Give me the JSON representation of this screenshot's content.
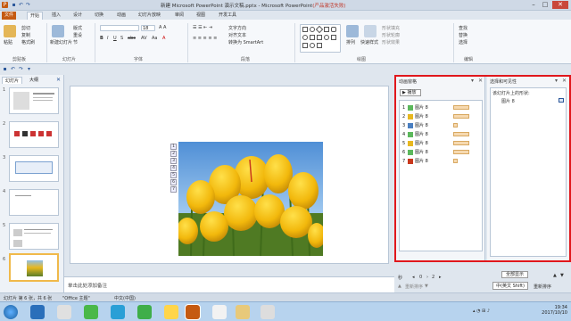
{
  "window": {
    "title": "新建 Microsoft PowerPoint 演示文稿.pptx - Microsoft PowerPoint",
    "title_suffix": "(产品激活失败)",
    "controls": [
      "–",
      "□",
      "✕"
    ]
  },
  "quick_access": [
    "save",
    "undo",
    "redo"
  ],
  "tabs": [
    {
      "label": "文件",
      "active": false
    },
    {
      "label": "开始",
      "active": true
    },
    {
      "label": "插入",
      "active": false
    },
    {
      "label": "设计",
      "active": false
    },
    {
      "label": "切换",
      "active": false
    },
    {
      "label": "动画",
      "active": false
    },
    {
      "label": "幻灯片放映",
      "active": false
    },
    {
      "label": "审阅",
      "active": false
    },
    {
      "label": "视图",
      "active": false
    },
    {
      "label": "开发工具",
      "active": false
    }
  ],
  "ribbon": {
    "clipboard": {
      "paste": "粘贴",
      "cut": "剪切",
      "copy": "复制",
      "format": "格式刷",
      "label": "剪贴板"
    },
    "slides": {
      "new_slide": "新建幻灯片",
      "layout": "版式",
      "reset": "重设",
      "section": "节",
      "label": "幻灯片"
    },
    "font": {
      "label": "字体",
      "size": "18"
    },
    "paragraph": {
      "text_direction": "文字方向",
      "align_text": "对齐文本",
      "smartart": "转换为 SmartArt",
      "label": "段落"
    },
    "drawing": {
      "arrange": "排列",
      "quick_styles": "快速样式",
      "fill": "形状填充",
      "outline": "形状轮廓",
      "effects": "形状效果",
      "label": "绘图"
    },
    "editing": {
      "find": "查找",
      "replace": "替换",
      "select": "选择",
      "label": "编辑"
    }
  },
  "left_panel": {
    "tabs": [
      "幻灯片",
      "大纲"
    ],
    "slide_numbers": [
      "1",
      "2",
      "3",
      "4",
      "5",
      "6"
    ],
    "selected": 6
  },
  "slide": {
    "anim_tags": [
      "1",
      "2",
      "3",
      "4",
      "5",
      "6",
      "7"
    ]
  },
  "notes_placeholder": "单击此处添加备注",
  "animation_pane": {
    "title": "动画窗格",
    "play": "播放",
    "items": [
      {
        "num": "1",
        "label": "图片 8",
        "bar": 0.6
      },
      {
        "num": "2",
        "label": "图片 8",
        "bar": 0.6
      },
      {
        "num": "3",
        "label": "图片 8",
        "bar": 0.15
      },
      {
        "num": "4",
        "label": "图片 8",
        "bar": 0.6
      },
      {
        "num": "5",
        "label": "图片 8",
        "bar": 0.6
      },
      {
        "num": "6",
        "label": "图片 8",
        "bar": 0.6
      },
      {
        "num": "7",
        "label": "图片 8",
        "bar": 0.15
      }
    ],
    "seconds_label": "秒",
    "start": "0",
    "end": "2",
    "reorder": "重新排序"
  },
  "selection_pane": {
    "title": "选择和可见性",
    "heading": "该幻灯片上的形状:",
    "items": [
      "图片 8"
    ],
    "show_all": "全部显示",
    "hide_all": "全部隐藏",
    "reorder": "重新排序"
  },
  "status": {
    "slide_info": "幻灯片 第 6 张，共 6 张",
    "theme": "\"Office 主题\"",
    "language": "中文(中国)"
  },
  "ime": "中(英文 Shift)",
  "clock": {
    "time": "19:34",
    "date": "2017/10/10"
  },
  "colors": {
    "accent": "#c55a11",
    "highlight_box": "#e0171c",
    "selected_thumb": "#f0b94a"
  }
}
